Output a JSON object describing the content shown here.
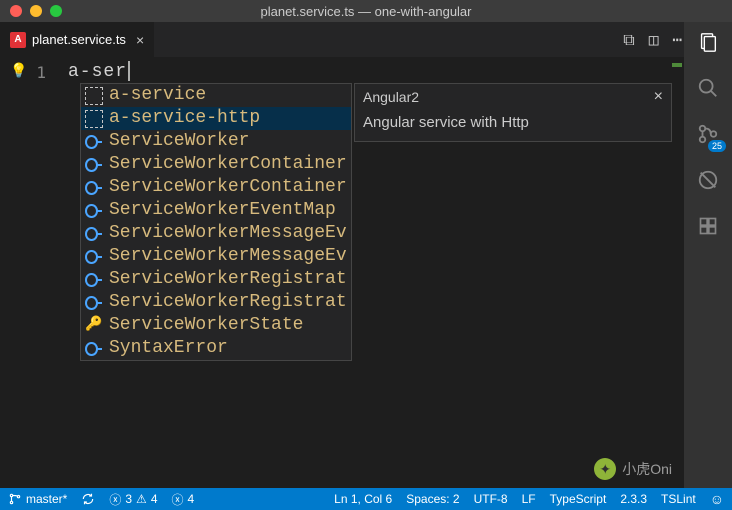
{
  "window": {
    "title": "planet.service.ts — one-with-angular"
  },
  "tab": {
    "filename": "planet.service.ts",
    "icon_letter": "A"
  },
  "editor": {
    "line_number": "1",
    "content": "a-ser"
  },
  "suggestions": {
    "items": [
      {
        "icon": "snippet",
        "label": "a-service"
      },
      {
        "icon": "snippet",
        "label": "a-service-http"
      },
      {
        "icon": "circ",
        "label": "ServiceWorker"
      },
      {
        "icon": "circ",
        "label": "ServiceWorkerContainer"
      },
      {
        "icon": "circ",
        "label": "ServiceWorkerContainerEv"
      },
      {
        "icon": "circ",
        "label": "ServiceWorkerEventMap"
      },
      {
        "icon": "circ",
        "label": "ServiceWorkerMessageEven"
      },
      {
        "icon": "circ",
        "label": "ServiceWorkerMessageEven"
      },
      {
        "icon": "circ",
        "label": "ServiceWorkerRegistratio"
      },
      {
        "icon": "circ",
        "label": "ServiceWorkerRegistratio"
      },
      {
        "icon": "key",
        "label": "ServiceWorkerState"
      },
      {
        "icon": "circ",
        "label": "SyntaxError"
      }
    ],
    "selected_index": 1
  },
  "details": {
    "title": "Angular2",
    "body": "Angular service with Http"
  },
  "rightbar": {
    "badge": "25"
  },
  "status": {
    "branch": "master*",
    "sync": "",
    "errors": "3",
    "warnings": "4",
    "errors2": "4",
    "position": "Ln 1, Col 6",
    "spaces": "Spaces: 2",
    "encoding": "UTF-8",
    "eol": "LF",
    "language": "TypeScript",
    "version": "2.3.3",
    "lint": "TSLint"
  },
  "watermark": {
    "text": "小虎Oni"
  }
}
